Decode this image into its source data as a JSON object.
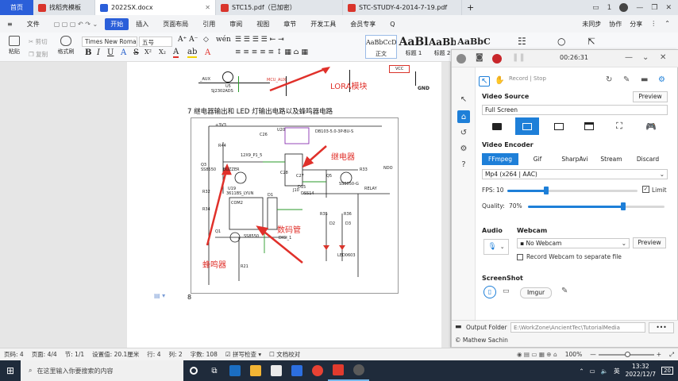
{
  "titlebar": {
    "home_tab": "首页",
    "tabs": [
      {
        "label": "找稻壳模板",
        "color": "#d9342b"
      },
      {
        "label": "2022SX.docx",
        "color": "#2b5fd9"
      },
      {
        "label": "STC15.pdf（已加密）",
        "color": "#d9342b"
      },
      {
        "label": "STC-STUDY-4-2014-7-19.pdf",
        "color": "#d9342b"
      }
    ],
    "add_tab": "+",
    "right_number": "1"
  },
  "menubar": {
    "items": [
      "文件",
      "开始",
      "插入",
      "页面布局",
      "引用",
      "审阅",
      "视图",
      "章节",
      "开发工具",
      "会员专享"
    ],
    "search_placeholder": "Q",
    "right_items": [
      "未同步",
      "协作",
      "分享"
    ]
  },
  "ribbon": {
    "paste": "粘贴",
    "cut": "剪切",
    "copy": "复制",
    "format_painter": "格式刷",
    "font_name": "Times New Roma",
    "font_size": "五号",
    "styles": [
      {
        "preview": "AaBbCcDd",
        "label": "正文"
      },
      {
        "preview": "AaBl",
        "label": "标题 1"
      },
      {
        "preview": "AaBb(",
        "label": "标题 2"
      },
      {
        "preview": "AaBbC",
        "label": "标题"
      }
    ]
  },
  "document": {
    "caption": "7  继电器输出和 LED 灯输出电路以及蜂鸣器电路",
    "page_number": "8",
    "annotations": {
      "lora": "LORA模块",
      "relay": "继电器",
      "display": "数码管",
      "buzzer": "蜂鸣器"
    },
    "schematic_labels": [
      "_AUX",
      "U5",
      "SJ2302ADS",
      "MCU_AUX",
      "VCC",
      "+3V3",
      "GND",
      "R44",
      "U20",
      "DB103-5.0-3P-BU-S",
      "Q3",
      "SS8550",
      "BUZZER",
      "J10",
      "12X9_P1_5",
      "R33",
      "Q5",
      "SS8050-G",
      "RELAY",
      "R32",
      "U19",
      "3611BS_LYUN",
      "COM2",
      "D1",
      "Q1",
      "SS8550",
      "R21",
      "R34",
      "D2",
      "D3",
      "LED0603",
      "R35",
      "R36",
      "NDO",
      "C26",
      "C27",
      "C28",
      "D15",
      "DSS14",
      "DIGI_1"
    ]
  },
  "recorder": {
    "time": "00:26:31",
    "record_stop": "Record | Stop",
    "video_source_label": "Video Source",
    "preview": "Preview",
    "source_value": "Full Screen",
    "video_encoder_label": "Video Encoder",
    "encoders": [
      "FFmpeg",
      "Gif",
      "SharpAvi",
      "Stream",
      "Discard"
    ],
    "codec": "Mp4 (x264 | AAC)",
    "fps_label": "FPS:",
    "fps_value": "10",
    "limit_label": "Limit",
    "quality_label": "Quality:",
    "quality_value": "70%",
    "audio_label": "Audio",
    "webcam_label": "Webcam",
    "webcam_value": "No Webcam",
    "webcam_preview": "Preview",
    "webcam_separate": "Record Webcam to separate file",
    "screenshot_label": "ScreenShot",
    "imgur": "Imgur",
    "output_label": "Output Folder",
    "output_path": "E:\\WorkZone\\AncientTec\\TutorialMedia",
    "more": "•••",
    "copyright": "© Mathew Sachin",
    "fps_fraction": 0.3,
    "quality_fraction": 0.7
  },
  "statusbar": {
    "page": "页码: 4",
    "pages": "页面: 4/4",
    "section": "节: 1/1",
    "setting": "设置值: 20.1厘米",
    "row": "行: 4",
    "col": "列: 2",
    "words": "字数: 108",
    "spell": "拼写检查",
    "proof": "文档校对",
    "zoom": "100%"
  },
  "taskbar": {
    "search_placeholder": "在这里输入你要搜索的内容",
    "time": "13:32",
    "date": "2022/12/7",
    "lang": "英",
    "notif": "20"
  }
}
